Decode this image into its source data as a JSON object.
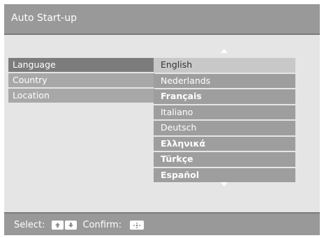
{
  "header": {
    "title": "Auto Start-up"
  },
  "left_menu": {
    "items": [
      {
        "label": "Language"
      },
      {
        "label": "Country"
      },
      {
        "label": "Location"
      }
    ]
  },
  "language_list": {
    "items": [
      {
        "label": "English"
      },
      {
        "label": "Nederlands"
      },
      {
        "label": "Français"
      },
      {
        "label": "Italiano"
      },
      {
        "label": "Deutsch"
      },
      {
        "label": "Ελληνικά"
      },
      {
        "label": "Türkçe"
      },
      {
        "label": "Español"
      }
    ]
  },
  "footer": {
    "select_label": "Select:",
    "confirm_label": "Confirm:"
  },
  "colors": {
    "title_bar": "#999999",
    "panel_bg": "#e5e5e5",
    "selected_left": "#7c7c7c",
    "focused_item": "#c8c8c8"
  }
}
